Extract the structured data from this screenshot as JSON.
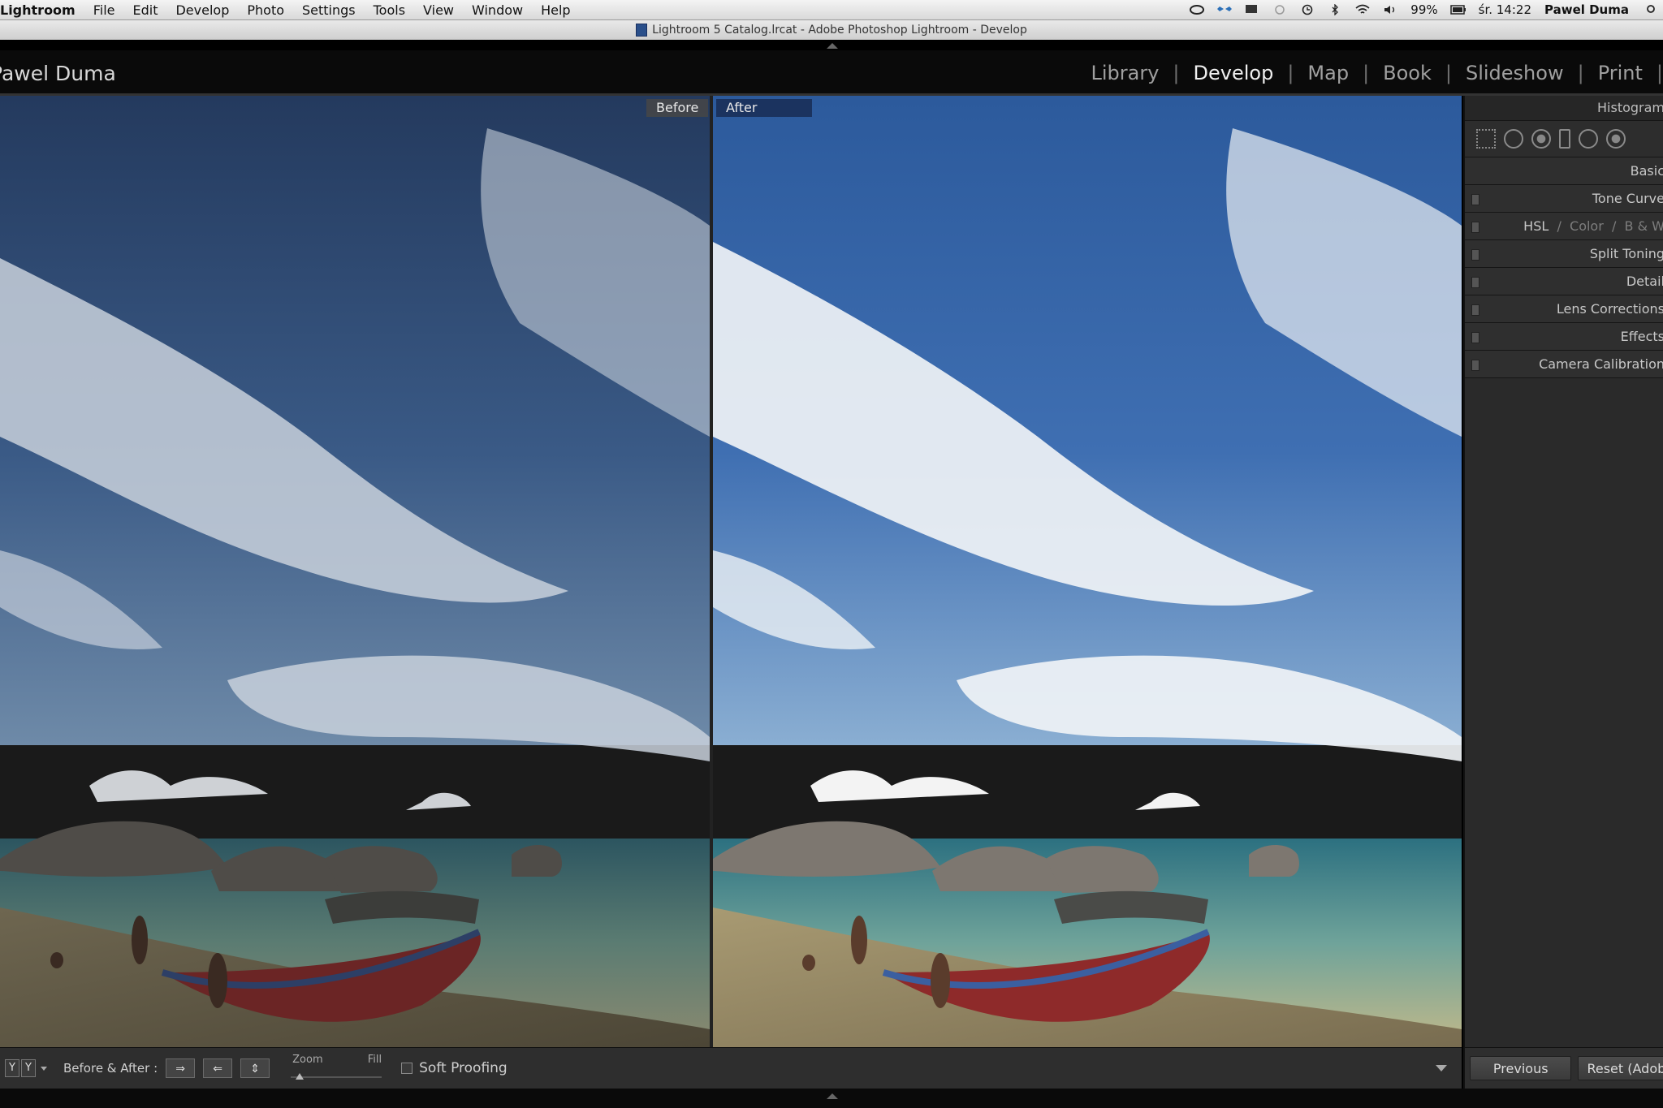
{
  "menubar": {
    "app_name": "Lightroom",
    "items": [
      "File",
      "Edit",
      "Develop",
      "Photo",
      "Settings",
      "Tools",
      "View",
      "Window",
      "Help"
    ],
    "battery": "99%",
    "clock": "śr. 14:22",
    "user": "Pawel Duma"
  },
  "window": {
    "title": "Lightroom 5 Catalog.lrcat - Adobe Photoshop Lightroom - Develop"
  },
  "header": {
    "identity_plate": "Pawel Duma",
    "modules": [
      "Library",
      "Develop",
      "Map",
      "Book",
      "Slideshow",
      "Print"
    ],
    "active_module": "Develop"
  },
  "view": {
    "before_label": "Before",
    "after_label": "After"
  },
  "right_panel": {
    "histogram": "Histogram",
    "basic": "Basic",
    "tone_curve": "Tone Curve",
    "hsl": "HSL",
    "color": "Color",
    "bw": "B & W",
    "split_toning": "Split Toning",
    "detail": "Detail",
    "lens_corrections": "Lens Corrections",
    "effects": "Effects",
    "camera_calibration": "Camera Calibration"
  },
  "toolbar": {
    "before_after_label": "Before & After :",
    "zoom_label": "Zoom",
    "zoom_value": "Fill",
    "soft_proofing": "Soft Proofing",
    "previous_button": "Previous",
    "reset_button": "Reset (Adobe)"
  },
  "colors": {
    "after_tag_bg": "#1e2d55",
    "panel_bg": "#2a2a2a",
    "header_bg": "#0a0a0a"
  }
}
